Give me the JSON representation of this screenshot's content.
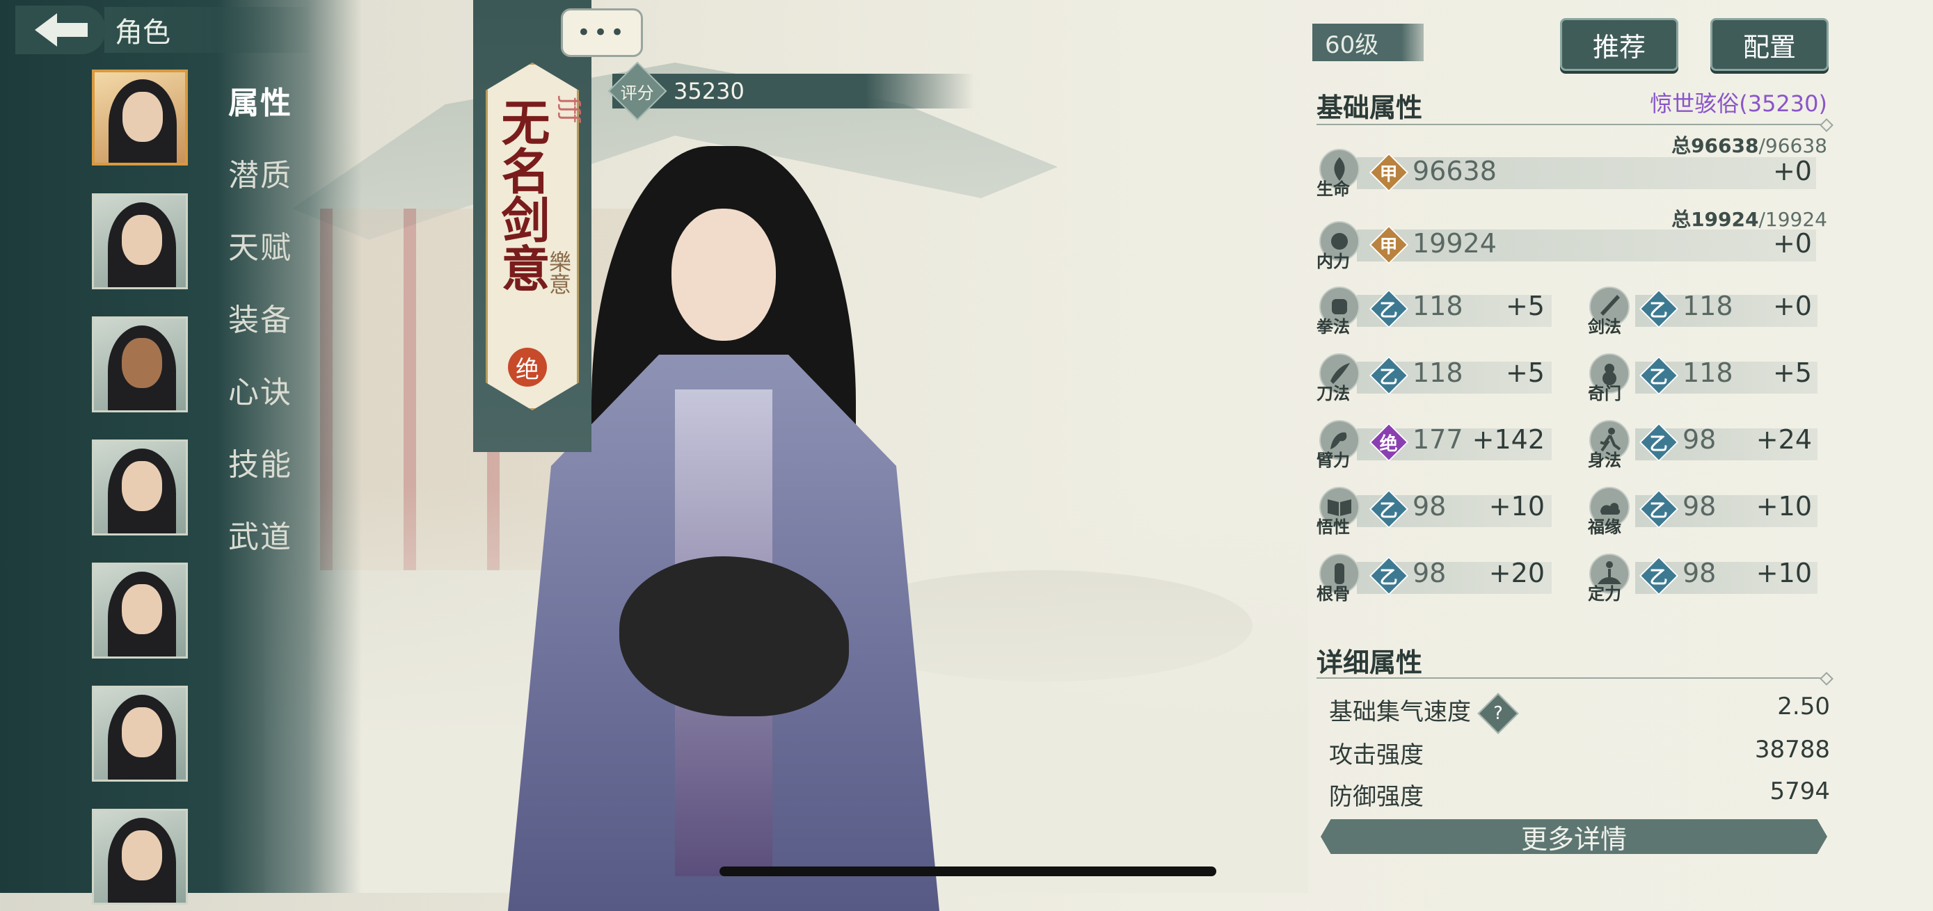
{
  "header": {
    "title": "角色"
  },
  "menu": [
    "属性",
    "潜质",
    "天赋",
    "装备",
    "心诀",
    "技能",
    "武道"
  ],
  "banner": {
    "name": "无名剑意",
    "subtitle": "樂意",
    "badge": "绝",
    "chat": "•••"
  },
  "score": {
    "label": "评分",
    "value": "35230"
  },
  "right": {
    "level": "60级",
    "recommend_label": "推荐",
    "config_label": "配置",
    "basic_title": "基础属性",
    "rating_link": "惊世骇俗(35230)",
    "life": {
      "label": "生命",
      "grade": "甲",
      "value": "96638",
      "bonus": "+0",
      "total_label": "总96638",
      "total_max": "/96638"
    },
    "neili": {
      "label": "内力",
      "grade": "甲",
      "value": "19924",
      "bonus": "+0",
      "total_label": "总19924",
      "total_max": "/19924"
    },
    "stats": [
      {
        "label": "拳法",
        "grade": "乙",
        "value": "118",
        "bonus": "+5",
        "plus": true
      },
      {
        "label": "剑法",
        "grade": "乙",
        "value": "118",
        "bonus": "+0",
        "plus": true
      },
      {
        "label": "刀法",
        "grade": "乙",
        "value": "118",
        "bonus": "+5",
        "plus": true
      },
      {
        "label": "奇门",
        "grade": "乙",
        "value": "118",
        "bonus": "+5",
        "plus": true
      },
      {
        "label": "臂力",
        "grade": "绝",
        "value": "177",
        "bonus": "+142",
        "plus": false
      },
      {
        "label": "身法",
        "grade": "乙",
        "value": "98",
        "bonus": "+24",
        "plus": false
      },
      {
        "label": "悟性",
        "grade": "乙",
        "value": "98",
        "bonus": "+10",
        "plus": false
      },
      {
        "label": "福缘",
        "grade": "乙",
        "value": "98",
        "bonus": "+10",
        "plus": false
      },
      {
        "label": "根骨",
        "grade": "乙",
        "value": "98",
        "bonus": "+20",
        "plus": false
      },
      {
        "label": "定力",
        "grade": "乙",
        "value": "98",
        "bonus": "+10",
        "plus": false
      }
    ],
    "detail_title": "详细属性",
    "details": [
      {
        "label": "基础集气速度",
        "value": "2.50",
        "help": "?"
      },
      {
        "label": "攻击强度",
        "value": "38788"
      },
      {
        "label": "防御强度",
        "value": "5794"
      }
    ],
    "more_label": "更多详情"
  },
  "colors": {
    "panel_dark": "#264746",
    "accent_purple": "#8a55c9",
    "grade_jia": "#b9823e",
    "grade_yi": "#3d7a92",
    "grade_jue": "#8a3fb0"
  }
}
